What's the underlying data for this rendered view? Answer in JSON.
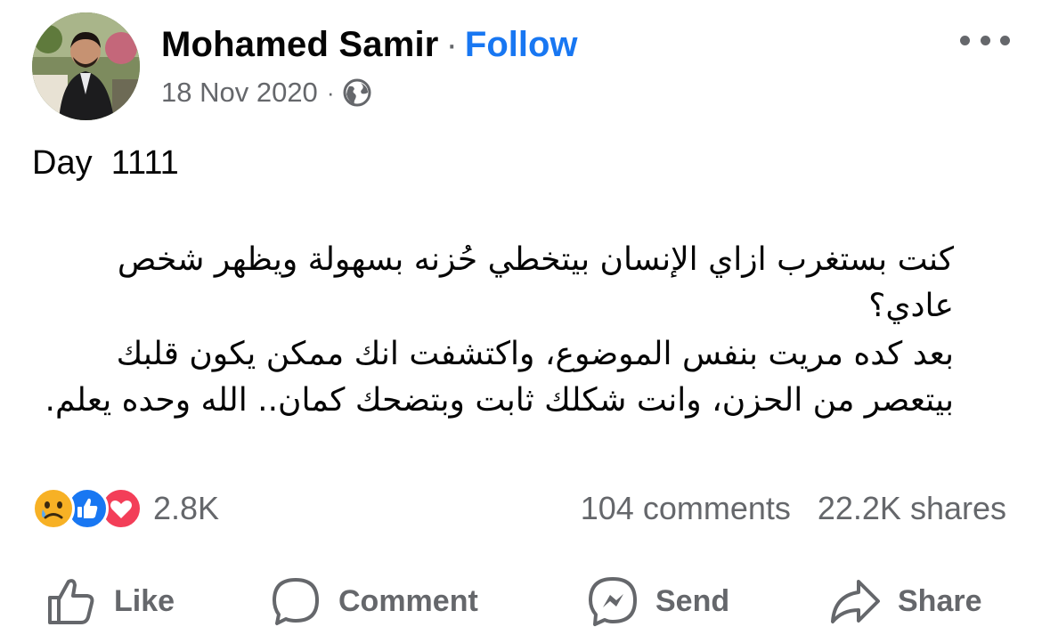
{
  "header": {
    "author_name": "Mohamed Samir",
    "separator": "·",
    "follow_label": "Follow",
    "date": "18 Nov 2020",
    "meta_separator": "·",
    "privacy_icon": "globe-icon",
    "more_icon": "more-options-icon"
  },
  "post": {
    "day_line": "Day  1111",
    "paragraph_1": "كنت بستغرب ازاي الإنسان بيتخطي حُزنه بسهولة ويظهر شخص عادي؟",
    "paragraph_2": "بعد كده مريت بنفس الموضوع، واكتشفت انك ممكن يكون قلبك بيتعصر من الحزن، وانت شكلك ثابت وبتضحك كمان.. الله وحده يعلم."
  },
  "engagement": {
    "reaction_icons": [
      "sad-reaction-icon",
      "like-reaction-icon",
      "love-reaction-icon"
    ],
    "reaction_count": "2.8K",
    "comments": "104 comments",
    "shares": "22.2K shares"
  },
  "actions": {
    "like": "Like",
    "comment": "Comment",
    "send": "Send",
    "share": "Share"
  },
  "colors": {
    "brand": "#1877f2",
    "secondary_text": "#65676b",
    "primary_text": "#050505"
  }
}
